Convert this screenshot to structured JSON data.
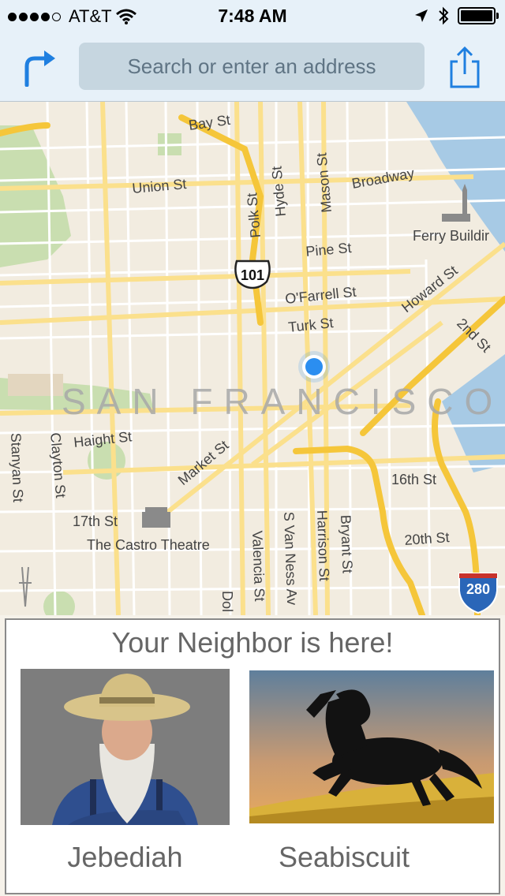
{
  "status_bar": {
    "carrier": "AT&T",
    "time": "7:48 AM",
    "signal_bars_filled": 4,
    "signal_bars_total": 5
  },
  "nav": {
    "search_placeholder": "Search or enter an address",
    "directions_icon": "directions-arrow-icon",
    "share_icon": "share-icon"
  },
  "map": {
    "city_label": "SAN FRANCISCO",
    "street_labels": {
      "bay": "Bay St",
      "union": "Union St",
      "polk": "Polk St",
      "hyde": "Hyde St",
      "mason": "Mason St",
      "broadway": "Broadway",
      "ferry": "Ferry Buildir",
      "pine": "Pine St",
      "ofarrell": "O'Farrell St",
      "turk": "Turk St",
      "howard": "Howard St",
      "second": "2nd St",
      "haight": "Haight St",
      "stanyan": "Stanyan St",
      "clayton": "Clayton St",
      "market": "Market St",
      "sixteenth": "16th St",
      "seventeenth": "17th St",
      "castro": "The Castro Theatre",
      "valencia": "Valencia St",
      "svanness": "S Van Ness Av",
      "harrison": "Harrison St",
      "bryant": "Bryant St",
      "twentieth": "20th St",
      "dolores": "Dol"
    },
    "shields": {
      "us101": "101",
      "i280": "280"
    },
    "colors": {
      "water": "#a7cae5",
      "park": "#c9deb0",
      "land": "#f2ece0",
      "highway": "#f5c63a",
      "major": "#fbe08c",
      "location": "#2b8ef0"
    }
  },
  "card": {
    "title": "Your Neighbor is here!",
    "neighbors": [
      {
        "name": "Jebediah"
      },
      {
        "name": "Seabiscuit"
      }
    ]
  }
}
